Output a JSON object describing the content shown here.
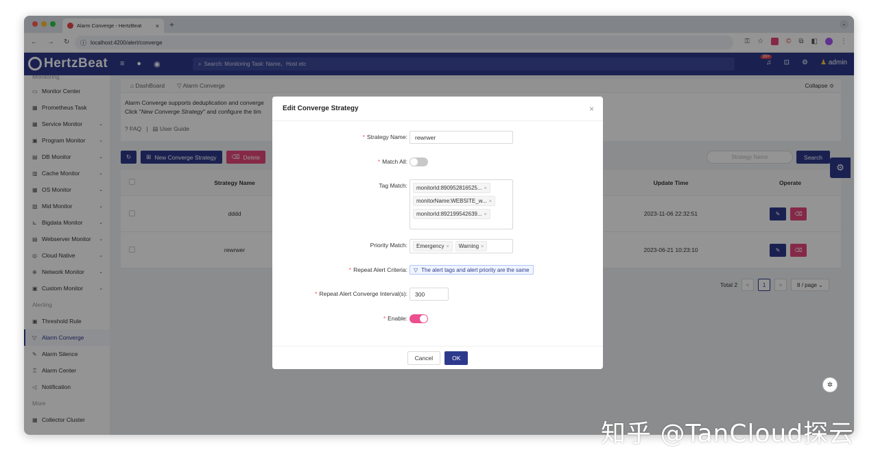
{
  "browser": {
    "tab_title": "Alarm Converge - HertzBeat",
    "tab_close": "×",
    "new_tab": "+",
    "url": "localhost:4200/alert/converge"
  },
  "header": {
    "logo": "HertzBeat",
    "search_placeholder": "Search:  Monitoring Task: Name、Host etc",
    "badge": "99+",
    "user": "admin"
  },
  "sidebar": {
    "group_monitoring": "Monitoring",
    "items_monitoring": [
      {
        "label": "Monitor Center",
        "icon": "▭",
        "chev": ""
      },
      {
        "label": "Prometheus Task",
        "icon": "▦",
        "chev": ""
      },
      {
        "label": "Service Monitor",
        "icon": "▦",
        "chev": "⌄"
      },
      {
        "label": "Program Monitor",
        "icon": "▣",
        "chev": "⌄"
      },
      {
        "label": "DB Monitor",
        "icon": "▤",
        "chev": "⌄"
      },
      {
        "label": "Cache Monitor",
        "icon": "▥",
        "chev": "⌄"
      },
      {
        "label": "OS Monitor",
        "icon": "▦",
        "chev": "⌄"
      },
      {
        "label": "Mid Monitor",
        "icon": "▧",
        "chev": "⌄"
      },
      {
        "label": "Bigdata Monitor",
        "icon": "⊾",
        "chev": "⌄"
      },
      {
        "label": "Webserver Monitor",
        "icon": "▤",
        "chev": "⌄"
      },
      {
        "label": "Cloud Native",
        "icon": "◎",
        "chev": "⌄"
      },
      {
        "label": "Network Monitor",
        "icon": "⊕",
        "chev": "⌄"
      },
      {
        "label": "Custom Monitor",
        "icon": "▣",
        "chev": "⌄"
      }
    ],
    "group_alerting": "Alerting",
    "items_alerting": [
      {
        "label": "Threshold Rule",
        "icon": "▣"
      },
      {
        "label": "Alarm Converge",
        "icon": "▽"
      },
      {
        "label": "Alarm Silence",
        "icon": "✎"
      },
      {
        "label": "Alarm Center",
        "icon": "♖"
      },
      {
        "label": "Notification",
        "icon": "◁"
      }
    ],
    "group_more": "More",
    "items_more": [
      {
        "label": "Collector Cluster",
        "icon": "▦"
      }
    ]
  },
  "breadcrumb": {
    "home": "DashBoard",
    "current": "Alarm Converge",
    "collapse": "Collapse ≎"
  },
  "description": {
    "line1": "Alarm Converge supports deduplication and converge",
    "line2_prefix": "Click \"",
    "line2_em": "New Converge Strategy",
    "line2_suffix": "\" and configure the tim",
    "faq": "FAQ",
    "sep": "|",
    "guide": "User Guide"
  },
  "toolbar": {
    "refresh": "↻",
    "new": "New Converge Strategy",
    "delete": "Delete",
    "search_placeholder": "Strategy Name",
    "search": "Search"
  },
  "table": {
    "headers": [
      "Strategy Name",
      "Update Time",
      "Operate"
    ],
    "rows": [
      {
        "name": "dddd",
        "time": "2023-11-06 22:32:51"
      },
      {
        "name": "rewrwer",
        "time": "2023-06-21 10:23:10"
      }
    ]
  },
  "pagination": {
    "total": "Total 2",
    "prev": "<",
    "page": "1",
    "next": ">",
    "size": "8 / page ⌄"
  },
  "modal": {
    "title": "Edit Converge Strategy",
    "close": "×",
    "strategy_name_label": "Strategy Name",
    "strategy_name_value": "rewrwer",
    "match_all_label": "Match All",
    "match_all_on": false,
    "tag_match_label": "Tag Match",
    "tags": [
      "monitorId:890952816525...",
      "monitorName:WEBSITE_w...",
      "monitorId:892199542639..."
    ],
    "priority_match_label": "Priority Match",
    "priorities": [
      "Emergency",
      "Warning"
    ],
    "criteria_label": "Repeat Alert Criteria",
    "criteria_value": "The alert tags and alert priority are the same",
    "interval_label": "Repeat Alert Converge Interval(s)",
    "interval_value": "300",
    "enable_label": "Enable",
    "enable_on": true,
    "cancel": "Cancel",
    "ok": "OK"
  },
  "watermark": "知乎 @TanCloud探云",
  "colors": {
    "primary": "#2d3a8c",
    "danger": "#e5487a",
    "toggle_on": "#ec4f8f"
  }
}
